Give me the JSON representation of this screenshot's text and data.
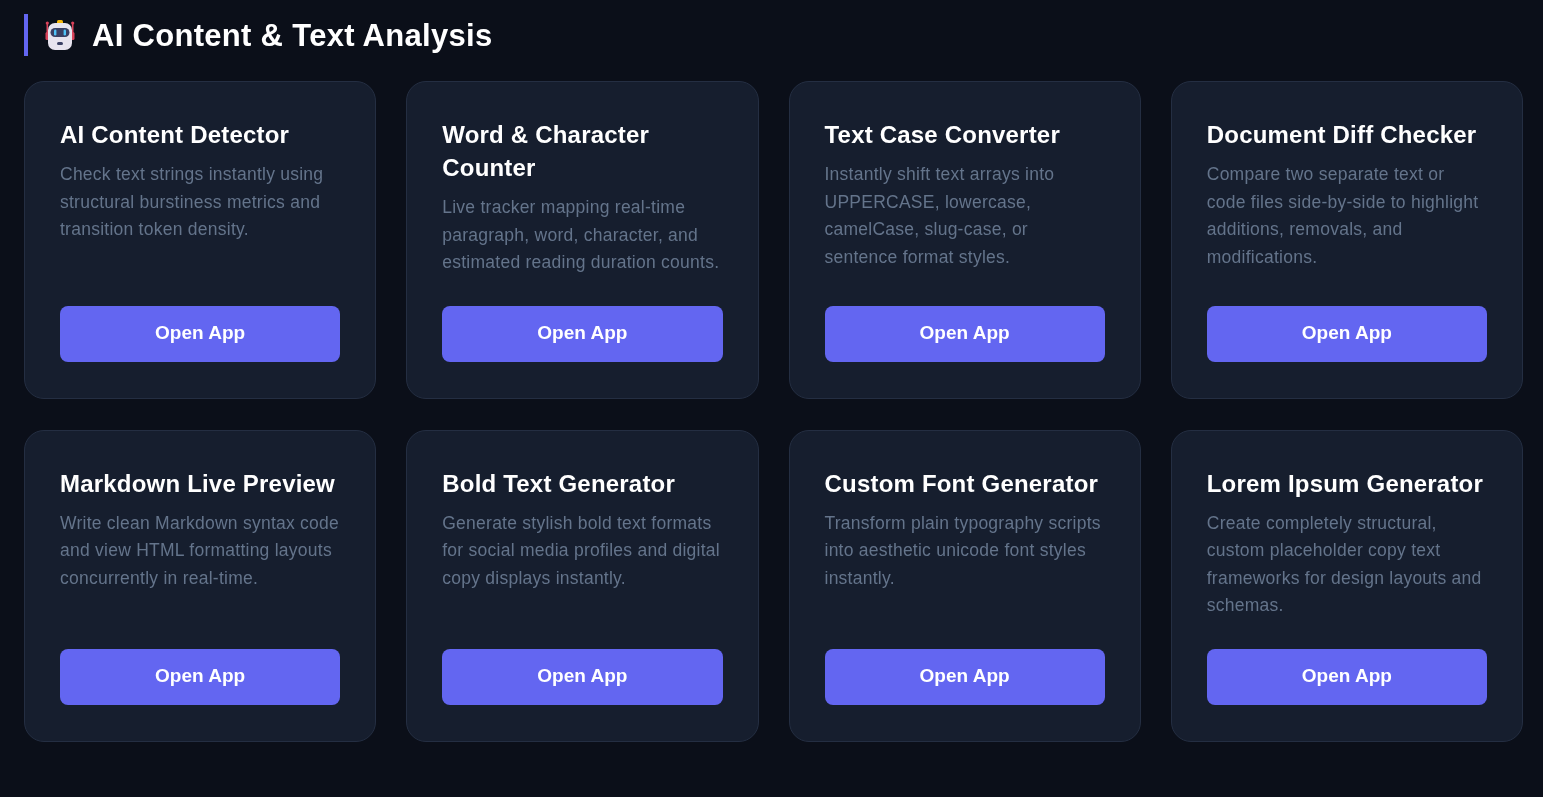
{
  "section": {
    "title": "AI Content & Text Analysis"
  },
  "tools": [
    {
      "title": "AI Content Detector",
      "description": "Check text strings instantly using structural burstiness metrics and transition token density.",
      "button": "Open App"
    },
    {
      "title": "Word & Character Counter",
      "description": "Live tracker mapping real-time paragraph, word, character, and estimated reading duration counts.",
      "button": "Open App"
    },
    {
      "title": "Text Case Converter",
      "description": "Instantly shift text arrays into UPPERCASE, lowercase, camelCase, slug-case, or sentence format styles.",
      "button": "Open App"
    },
    {
      "title": "Document Diff Checker",
      "description": "Compare two separate text or code files side-by-side to highlight additions, removals, and modifications.",
      "button": "Open App"
    },
    {
      "title": "Markdown Live Preview",
      "description": "Write clean Markdown syntax code and view HTML formatting layouts concurrently in real-time.",
      "button": "Open App"
    },
    {
      "title": "Bold Text Generator",
      "description": "Generate stylish bold text formats for social media profiles and digital copy displays instantly.",
      "button": "Open App"
    },
    {
      "title": "Custom Font Generator",
      "description": "Transform plain typography scripts into aesthetic unicode font styles instantly.",
      "button": "Open App"
    },
    {
      "title": "Lorem Ipsum Generator",
      "description": "Create completely structural, custom placeholder copy text frameworks for design layouts and schemas.",
      "button": "Open App"
    }
  ]
}
